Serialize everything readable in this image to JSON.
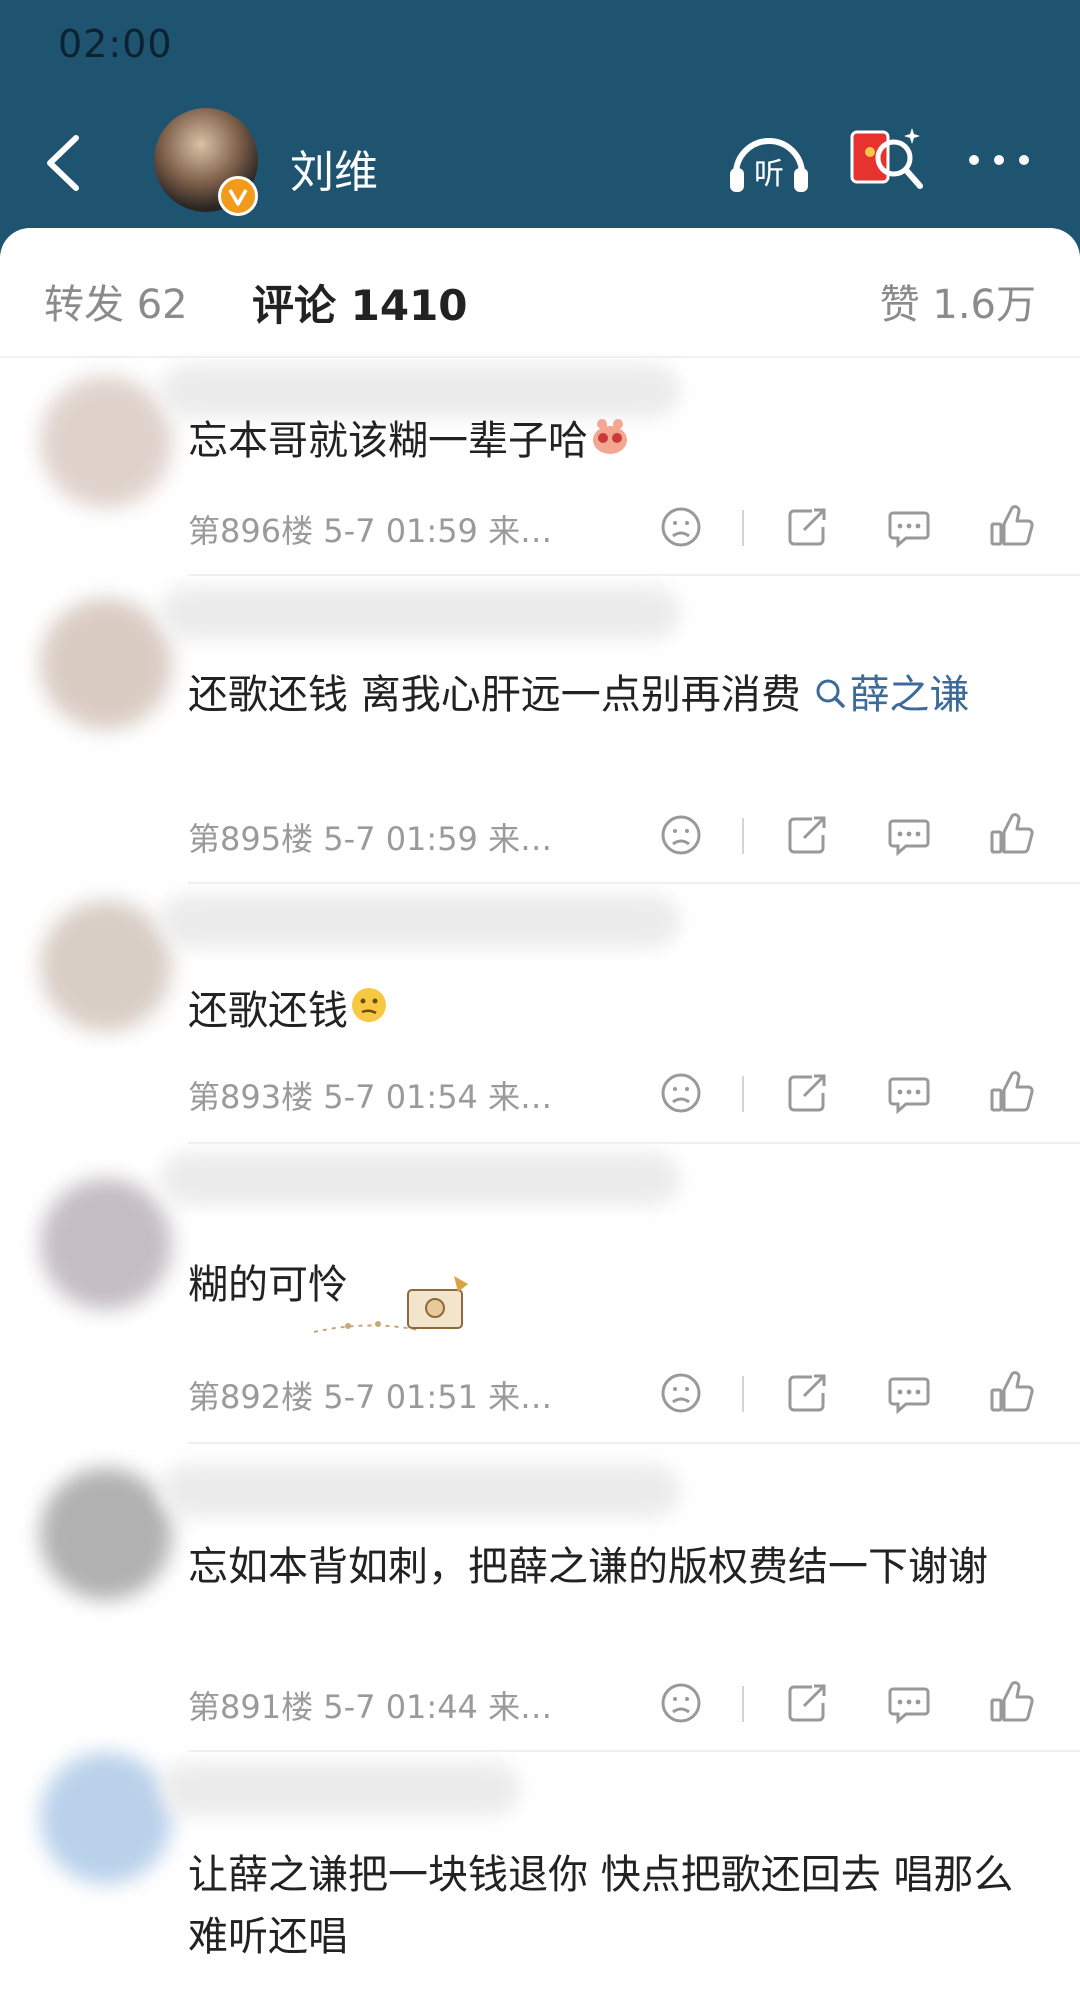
{
  "status_bar": {
    "time": "02:00"
  },
  "header": {
    "username": "刘维",
    "icons": [
      "back-icon",
      "listen-icon",
      "red-packet-icon",
      "more-icon"
    ],
    "listen_label": "听",
    "background_color": "#1e5470",
    "verified_badge_color": "#f39a1a"
  },
  "tabs": {
    "reposts": "转发 62",
    "comments": "评论 1410",
    "likes": "赞 1.6万"
  },
  "comments": [
    {
      "text": "忘本哥就该糊一辈子哈",
      "topic": "",
      "text_after": "",
      "meta": "第896楼  5-7 01:59  来…"
    },
    {
      "text": "还歌还钱 离我心肝远一点别再消费 ",
      "topic": "薛之谦",
      "text_after": "",
      "meta": "第895楼  5-7 01:59  来…"
    },
    {
      "text": "还歌还钱",
      "topic": "",
      "text_after": "",
      "meta": "第893楼  5-7 01:54  来…"
    },
    {
      "text": "糊的可怜",
      "topic": "",
      "text_after": "",
      "meta": "第892楼  5-7 01:51  来…"
    },
    {
      "text": "忘如本背如刺，把薛之谦的版权费结一下谢谢",
      "topic": "",
      "text_after": "",
      "meta": "第891楼  5-7 01:44  来…"
    },
    {
      "text": "让薛之谦把一块钱退你 快点把歌还回去 唱那么难听还唱",
      "topic": "",
      "text_after": "",
      "meta": ""
    }
  ],
  "action_icons": [
    "dislike-icon",
    "share-icon",
    "reply-icon",
    "like-icon"
  ],
  "topic_color": "#3d6a99"
}
